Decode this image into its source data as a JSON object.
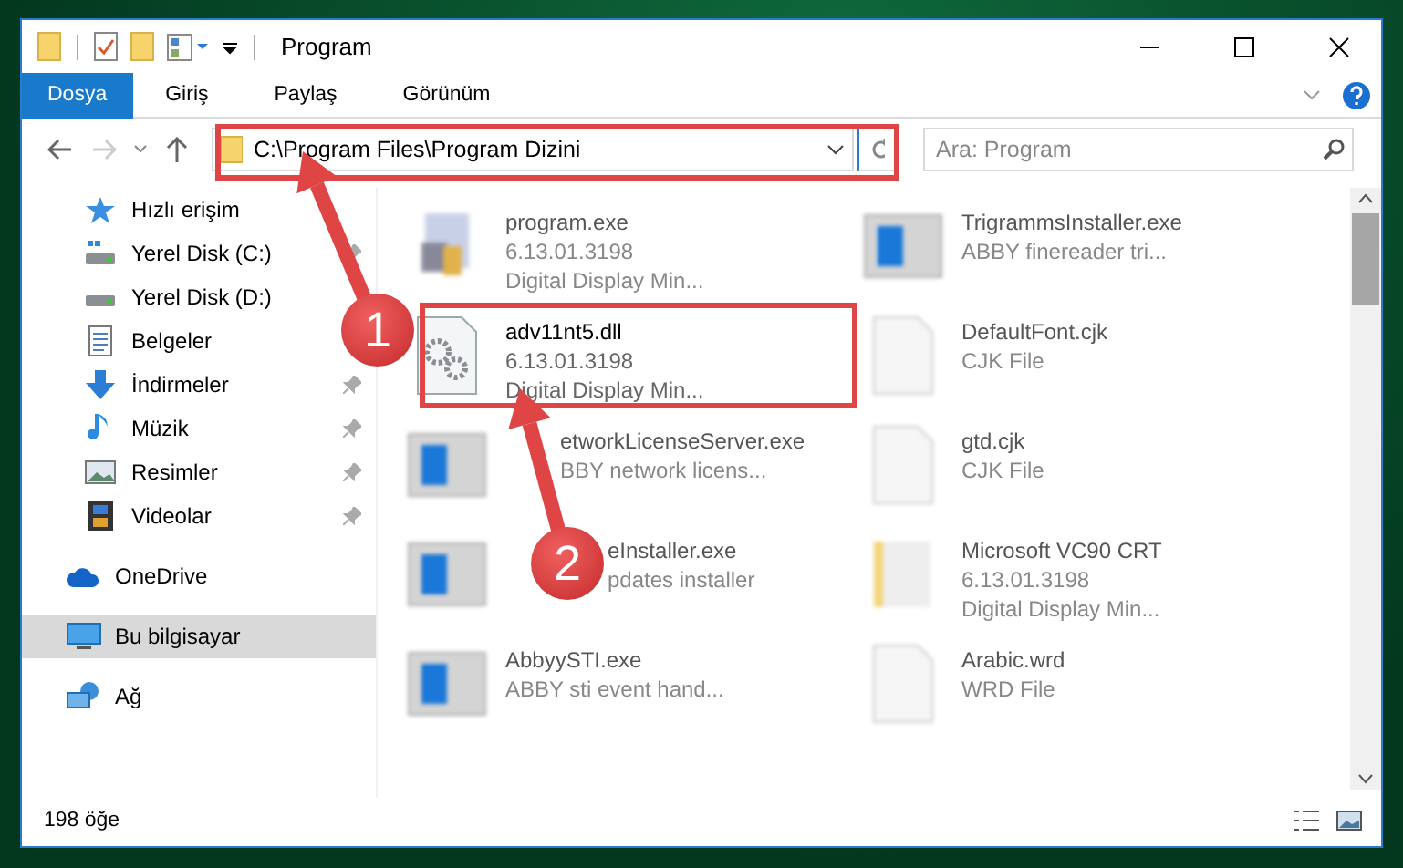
{
  "window": {
    "title": "Program"
  },
  "ribbon_tabs": [
    {
      "label": "Dosya",
      "kind": "file",
      "selected": false
    },
    {
      "label": "Giriş",
      "kind": "tab",
      "selected": false
    },
    {
      "label": "Paylaş",
      "kind": "tab",
      "selected": false
    },
    {
      "label": "Görünüm",
      "kind": "tab",
      "selected": false
    }
  ],
  "address": {
    "path": "C:\\Program Files\\Program Dizini"
  },
  "search": {
    "placeholder": "Ara: Program"
  },
  "sidebar": {
    "items": [
      {
        "label": "Hızlı erişim",
        "kind": "star",
        "pinned": false,
        "selected": false
      },
      {
        "label": "Yerel Disk (C:)",
        "kind": "windisk",
        "pinned": true,
        "selected": false
      },
      {
        "label": "Yerel Disk (D:)",
        "kind": "disk",
        "pinned": false,
        "selected": false
      },
      {
        "label": "Belgeler",
        "kind": "docs",
        "pinned": false,
        "selected": false
      },
      {
        "label": "İndirmeler",
        "kind": "download",
        "pinned": true,
        "selected": false
      },
      {
        "label": "Müzik",
        "kind": "music",
        "pinned": true,
        "selected": false
      },
      {
        "label": "Resimler",
        "kind": "pictures",
        "pinned": true,
        "selected": false
      },
      {
        "label": "Videolar",
        "kind": "videos",
        "pinned": true,
        "selected": false
      },
      {
        "label": "OneDrive",
        "kind": "cloud",
        "pinned": false,
        "selected": false
      },
      {
        "label": "Bu bilgisayar",
        "kind": "computer",
        "pinned": false,
        "selected": true
      },
      {
        "label": "Ağ",
        "kind": "network",
        "pinned": false,
        "selected": false
      }
    ]
  },
  "files": [
    {
      "kind": "app",
      "name": "program.exe",
      "details": [
        "6.13.01.3198",
        "Digital Display Min..."
      ],
      "blurred": true
    },
    {
      "kind": "exe",
      "name": "TrigrammsInstaller.exe",
      "details": [
        "ABBY finereader tri..."
      ],
      "blurred": true
    },
    {
      "kind": "dll",
      "name": "adv11nt5.dll",
      "details": [
        "6.13.01.3198",
        "Digital Display Min..."
      ],
      "blurred": false
    },
    {
      "kind": "file",
      "name": "DefaultFont.cjk",
      "details": [
        "CJK File"
      ],
      "blurred": true
    },
    {
      "kind": "exe",
      "name": "etworkLicenseServer.exe",
      "details": [
        "BBY network licens..."
      ],
      "blurred": true
    },
    {
      "kind": "file",
      "name": "gtd.cjk",
      "details": [
        "CJK File"
      ],
      "blurred": true
    },
    {
      "kind": "exe",
      "name": "eInstaller.exe",
      "details": [
        "pdates installer"
      ],
      "blurred": true
    },
    {
      "kind": "folder",
      "name": "Microsoft VC90 CRT",
      "details": [
        "6.13.01.3198",
        "Digital Display Min..."
      ],
      "blurred": true
    },
    {
      "kind": "exe",
      "name": "AbbyySTI.exe",
      "details": [
        "ABBY sti event hand..."
      ],
      "blurred": true
    },
    {
      "kind": "file",
      "name": "Arabic.wrd",
      "details": [
        "WRD File"
      ],
      "blurred": true
    }
  ],
  "status_bar": {
    "count": "198 öğe"
  },
  "callouts": [
    {
      "number": "1"
    },
    {
      "number": "2"
    }
  ]
}
